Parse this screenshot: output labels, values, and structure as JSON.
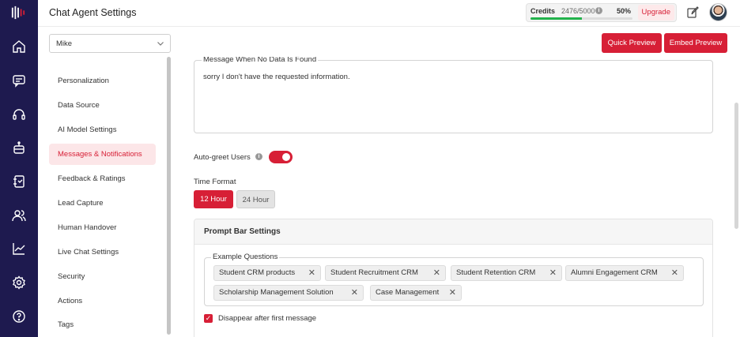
{
  "header": {
    "title": "Chat Agent Settings",
    "credits_label": "Credits",
    "credits_count": "2476/5000",
    "credits_percent": "50%",
    "credits_fraction": 0.5,
    "upgrade_label": "Upgrade",
    "info_glyph": "i"
  },
  "toolbar": {
    "agent_name": "Mike",
    "quick_preview": "Quick Preview",
    "embed_preview": "Embed Preview"
  },
  "rail": {
    "icons": [
      "home-icon",
      "chat-icon",
      "headset-icon",
      "bot-icon",
      "notebook-icon",
      "users-icon",
      "analytics-icon",
      "settings-icon",
      "help-icon"
    ]
  },
  "menu": {
    "items": [
      {
        "label": "Personalization"
      },
      {
        "label": "Data Source"
      },
      {
        "label": "AI Model Settings"
      },
      {
        "label": "Messages & Notifications",
        "active": true
      },
      {
        "label": "Feedback & Ratings"
      },
      {
        "label": "Lead Capture"
      },
      {
        "label": "Human Handover"
      },
      {
        "label": "Live Chat Settings"
      },
      {
        "label": "Security"
      },
      {
        "label": "Actions"
      },
      {
        "label": "Tags"
      }
    ]
  },
  "content": {
    "nodata_legend": "Message When No Data Is Found",
    "nodata_value": "sorry I don't have the requested information.",
    "autogreet_label": "Auto-greet Users",
    "autogreet_on": true,
    "time_format_label": "Time Format",
    "time_12": "12 Hour",
    "time_24": "24 Hour",
    "prompt_bar_title": "Prompt Bar Settings",
    "example_questions_legend": "Example Questions",
    "chips": [
      "Student CRM products",
      "Student Recruitment CRM",
      "Student Retention CRM",
      "Alumni Engagement CRM",
      "Scholarship Management Solution",
      "Case Management"
    ],
    "chip_remove_glyph": "✕",
    "disappear_label": "Disappear after first message",
    "disappear_checked": true,
    "check_glyph": "✓"
  },
  "colors": {
    "rail": "#1e1a4f",
    "accent": "#d71f36",
    "progress": "#22b24c"
  }
}
